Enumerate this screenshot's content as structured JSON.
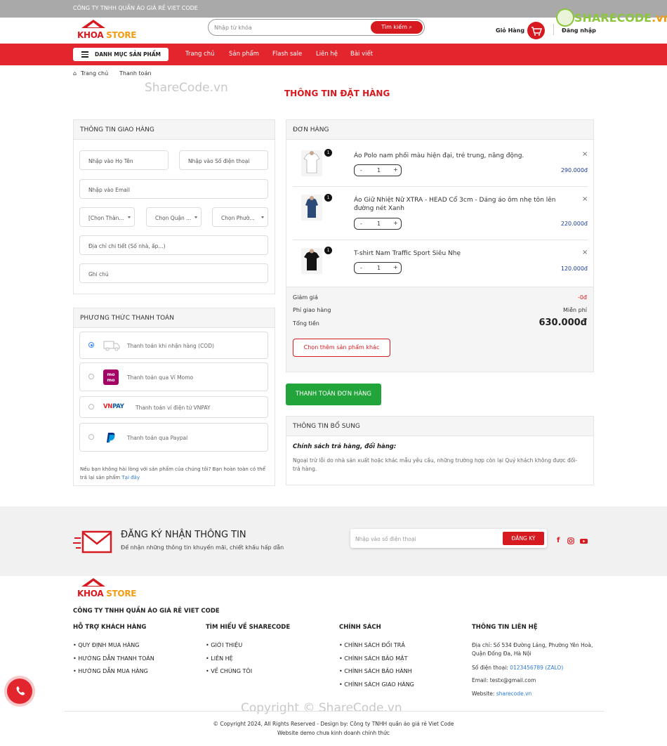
{
  "topbar": {
    "company": "CÔNG TY TNHH QUẦN ÁO GIÁ RẺ VIET CODE"
  },
  "header": {
    "logo_brand_red": "KHOA",
    "logo_brand_orange": "STORE",
    "search_placeholder": "Nhập từ khóa",
    "search_button": "Tìm kiếm",
    "cart_label": "Giỏ Hàng",
    "login_label": "Đăng nhập",
    "watermark_logo": "SHARECODE",
    "watermark_logo_suffix": ".vn"
  },
  "nav": {
    "category_button": "DANH MỤC SẢN PHẨM",
    "links": [
      "Trang chủ",
      "Sản phẩm",
      "Flash sale",
      "Liên hệ",
      "Bài viết"
    ]
  },
  "breadcrumb": {
    "home": "Trang chủ",
    "current": "Thanh toán"
  },
  "watermark_text": "ShareCode.vn",
  "page_title": "THÔNG TIN ĐẶT HÀNG",
  "shipping": {
    "title": "THÔNG TIN GIAO HÀNG",
    "name_placeholder": "Nhập vào Họ Tên",
    "phone_placeholder": "Nhập vào Số điện thoại",
    "email_placeholder": "Nhập vào Email",
    "city_select": "[Chọn Thàn...",
    "district_select": "Chọn Quận ...",
    "ward_select": "Chọn Phườ...",
    "address_placeholder": "Địa chỉ chi tiết (Số nhà, ấp...)",
    "note_placeholder": "Ghi chú"
  },
  "payment": {
    "title": "PHƯƠNG THỨC THANH TOÁN",
    "options": [
      {
        "label": "Thanh toán khi nhận hàng (COD)",
        "icon": "truck-icon",
        "selected": true
      },
      {
        "label": "Thanh toán qua Ví Momo",
        "icon": "momo-icon",
        "selected": false
      },
      {
        "label": "Thanh toán ví điện tử VNPAY",
        "icon": "vnpay-icon",
        "selected": false
      },
      {
        "label": "Thanh toán qua Paypal",
        "icon": "paypal-icon",
        "selected": false
      }
    ],
    "momo_logo_top": "mo",
    "momo_logo_bottom": "mo",
    "vnpay_logo_vn": "VN",
    "vnpay_logo_pay": "PAY",
    "return_note": "Nếu bạn không hài lòng với sản phẩm của chúng tôi? Bạn hoàn toàn có thể trả lại sản phẩm",
    "return_link": "Tại đây"
  },
  "order": {
    "title": "ĐƠN HÀNG",
    "items": [
      {
        "name": "Áo Polo nam phối màu hiện đại, trẻ trung, năng động.",
        "qty": "1",
        "badge": "1",
        "price": "290.000đ"
      },
      {
        "name": "Áo Giữ Nhiệt Nữ XTRA - HEAD Cổ 3cm - Dáng áo ôm nhẹ tôn lên đường nét Xanh",
        "qty": "1",
        "badge": "1",
        "price": "220.000đ"
      },
      {
        "name": "T-shirt Nam Traffic Sport Siêu Nhẹ",
        "qty": "1",
        "badge": "1",
        "price": "120.000đ"
      }
    ],
    "qty_minus": "-",
    "qty_plus": "+",
    "remove": "×",
    "discount_label": "Giảm giá",
    "discount_value": "-0đ",
    "shipping_label": "Phí giao hàng",
    "shipping_value": "Miễn phí",
    "total_label": "Tổng tiền",
    "total_value": "630.000đ",
    "more_button": "Chọn thêm sản phẩm khác",
    "checkout_button": "THANH TOÁN ĐƠN HÀNG"
  },
  "extra": {
    "title": "THÔNG TIN BỔ SUNG",
    "policy_title": "Chính sách trả hàng, đổi hàng:",
    "policy_text": "Ngoại trừ lỗi do nhà sản xuất hoặc khác mẫu yêu cầu, những trường hợp còn lại Quý khách không được đổi-trả hàng."
  },
  "newsletter": {
    "title": "ĐĂNG KÝ NHẬN THÔNG TIN",
    "subtitle": "Để nhận những thông tin khuyến mãi, chiết khấu hấp dẫn",
    "placeholder": "Nhập vào số điện thoại",
    "button": "ĐĂNG KÝ",
    "social_facebook": "f"
  },
  "footer": {
    "company": "CÔNG TY TNHH QUẦN ÁO GIÁ RẺ VIET CODE",
    "col1": {
      "title": "HỖ TRỢ KHÁCH HÀNG",
      "items": [
        "• QUY ĐỊNH MUA HÀNG",
        "• HƯỚNG DẪN THANH TOÁN",
        "• HƯỚNG DẪN MUA HÀNG"
      ]
    },
    "col2": {
      "title": "TÌM HIỂU VỀ SHARECODE",
      "items": [
        "• GIỚI THIỆU",
        "• LIÊN HỆ",
        "• VỀ CHÚNG TÔI"
      ]
    },
    "col3": {
      "title": "CHÍNH SÁCH",
      "items": [
        "• CHÍNH SÁCH ĐỔI TRẢ",
        "• CHÍNH SÁCH BẢO MẬT",
        "• CHÍNH SÁCH BẢO HÀNH",
        "• CHÍNH SÁCH GIAO HÀNG"
      ]
    },
    "col4": {
      "title": "THÔNG TIN LIÊN HỆ",
      "address": "Địa chỉ: Số 534 Đường Láng, Phường Yên Hoà, Quận Đống Đa, Hà Nội",
      "phone_label": "Số điện thoại:",
      "phone": "0123456789 (ZALO)",
      "email": "Email: testx@gmail.com",
      "website_label": "Website:",
      "website": "sharecode.vn"
    },
    "watermark_copyright": "Copyright © ShareCode.vn",
    "copyright": "© Copyright 2024, All Rights Reserved - Design by: Công ty TNHH quần áo giá rẻ Viet Code",
    "demo_note": "Website demo chưa kinh doanh chính thức"
  }
}
